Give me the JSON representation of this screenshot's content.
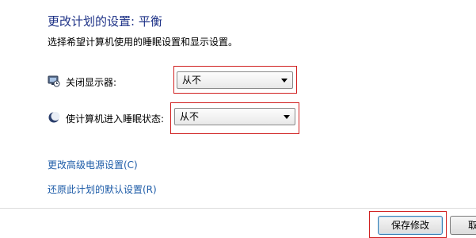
{
  "header": {
    "title": "更改计划的设置: 平衡",
    "subtitle": "选择希望计算机使用的睡眠设置和显示设置。"
  },
  "settings": [
    {
      "icon": "display-icon",
      "label": "关闭显示器:",
      "value": "从不"
    },
    {
      "icon": "sleep-moon-icon",
      "label": "使计算机进入睡眠状态:",
      "value": "从不"
    }
  ],
  "links": {
    "advanced": "更改高级电源设置(C)",
    "restore": "还原此计划的默认设置(R)"
  },
  "footer": {
    "save_label": "保存修改",
    "cancel_label": "取"
  },
  "colors": {
    "title": "#1e3287",
    "link": "#1e5ca8",
    "highlight": "#d02020"
  }
}
